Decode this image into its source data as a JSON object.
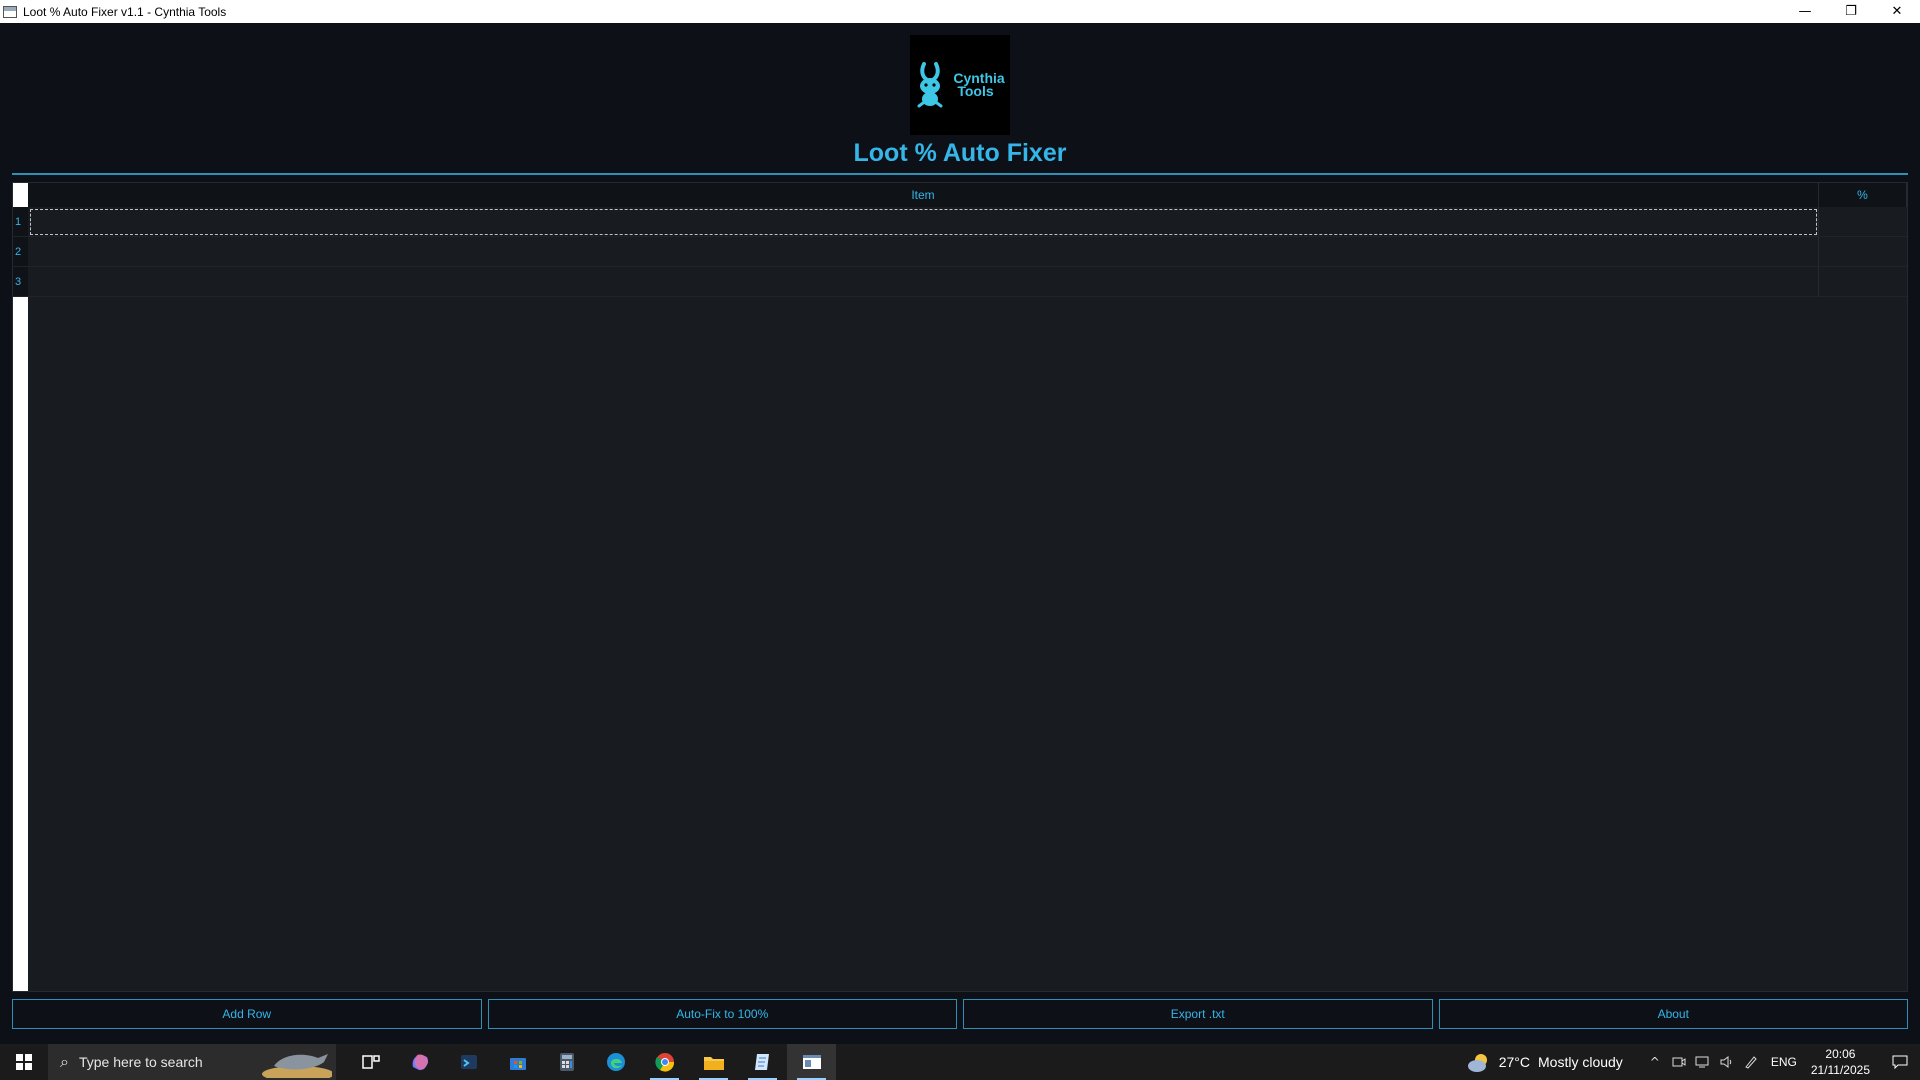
{
  "window": {
    "title": "Loot % Auto Fixer v1.1 - Cynthia Tools",
    "minimize_glyph": "—",
    "restore_glyph": "❐",
    "close_glyph": "✕"
  },
  "logo": {
    "line1": "Cynthia",
    "line2": "Tools"
  },
  "app_title": "Loot % Auto Fixer",
  "grid": {
    "columns": [
      "Item",
      "%"
    ],
    "rows": [
      {
        "num": "1",
        "item": "",
        "pct": ""
      },
      {
        "num": "2",
        "item": "",
        "pct": ""
      },
      {
        "num": "3",
        "item": "",
        "pct": ""
      }
    ]
  },
  "buttons": {
    "add_row": "Add Row",
    "auto_fix": "Auto-Fix to 100%",
    "export": "Export .txt",
    "about": "About"
  },
  "taskbar": {
    "search_placeholder": "Type here to search",
    "weather_temp": "27°C",
    "weather_desc": "Mostly cloudy",
    "lang": "ENG",
    "time": "20:06",
    "date": "21/11/2025"
  },
  "colors": {
    "accent": "#35b5e8",
    "background": "#0d1117",
    "grid_bg": "#181c21"
  }
}
